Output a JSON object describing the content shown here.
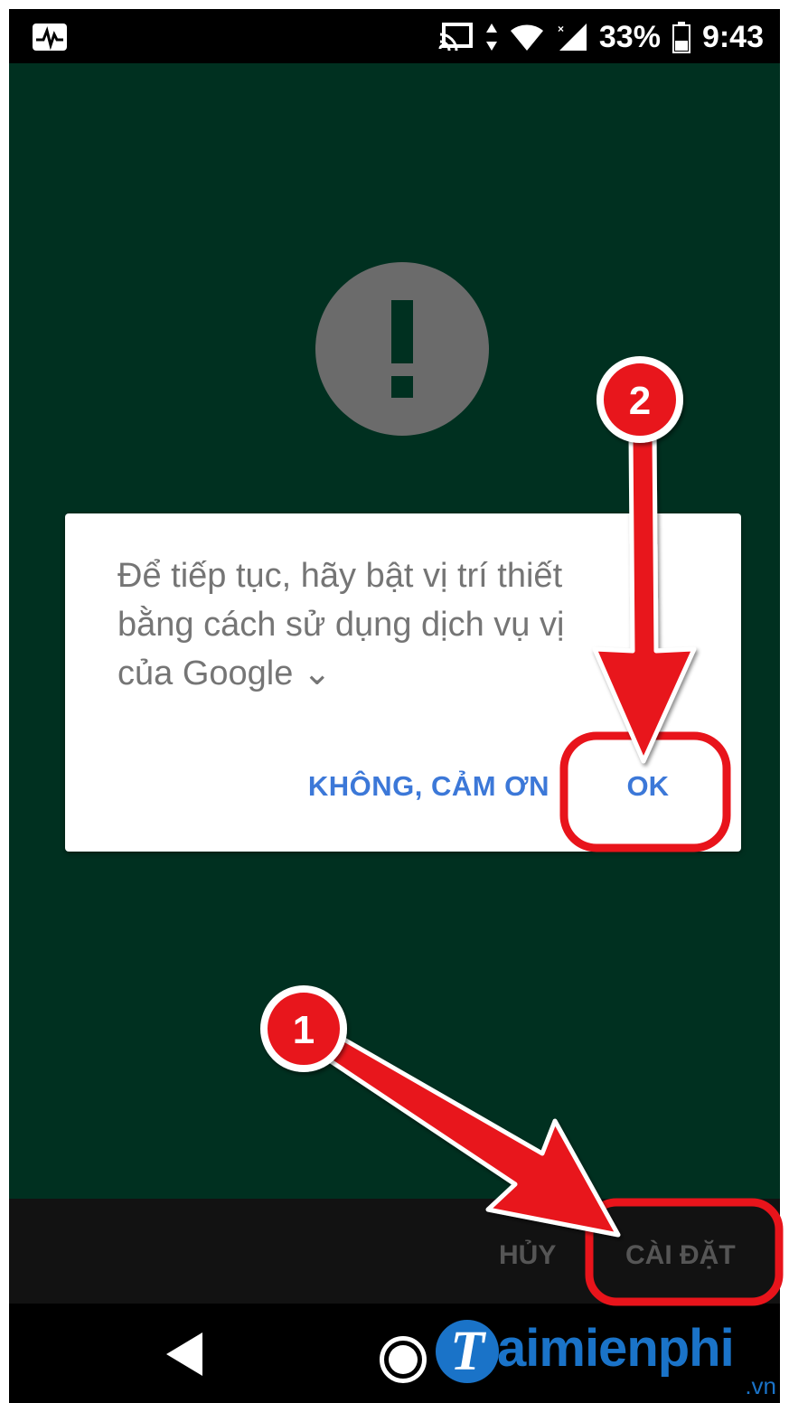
{
  "status_bar": {
    "battery": "33%",
    "time": "9:43",
    "left_icon": "activity-monitor-icon",
    "right_icons": [
      "cast-icon",
      "data-arrows-icon",
      "wifi-icon",
      "signal-icon",
      "battery-icon"
    ]
  },
  "screen": {
    "warning_icon": "exclamation-icon"
  },
  "dialog": {
    "message_line1": "Để tiếp tục, hãy bật vị trí thiết",
    "message_line2": "bằng cách sử dụng dịch vụ vị",
    "message_line3": "của Google ⌄",
    "no_button": "KHÔNG, CẢM ƠN",
    "ok_button": "OK"
  },
  "bottom_bar": {
    "cancel": "HỦY",
    "settings": "CÀI ĐẶT"
  },
  "annotations": {
    "step1": "1",
    "step2": "2",
    "highlight_color": "#e8141b"
  },
  "watermark": {
    "logo_letter": "T",
    "text": "aimienphi",
    "tld": ".vn"
  },
  "colors": {
    "background": "#003020",
    "dialog_button": "#3c78d8",
    "dialog_text": "#757575"
  }
}
